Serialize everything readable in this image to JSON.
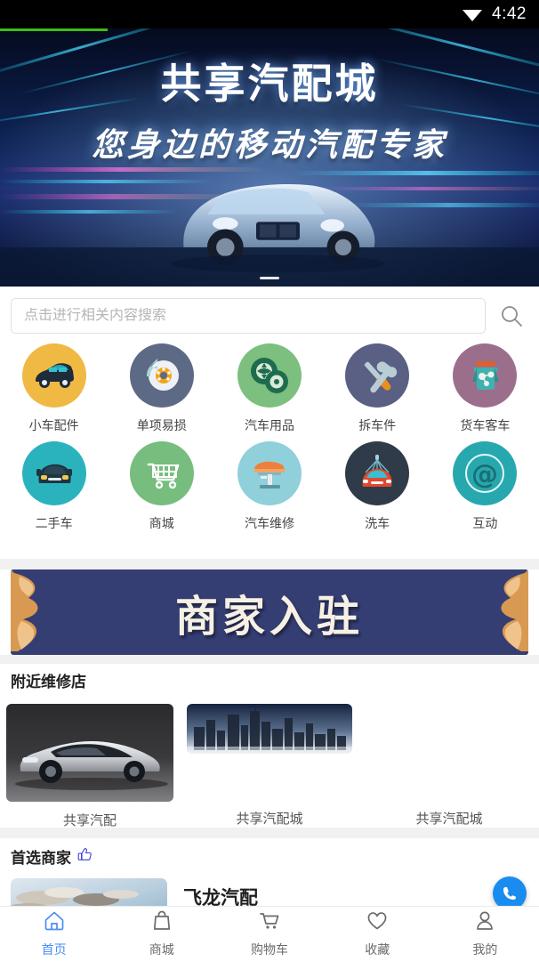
{
  "statusbar": {
    "time": "4:42",
    "wifi_icon": "wifi-icon"
  },
  "loading": {
    "progress_percent": 20
  },
  "hero": {
    "title": "共享汽配城",
    "subtitle": "您身边的移动汽配专家",
    "pager_indicator": "—"
  },
  "search": {
    "placeholder": "点击进行相关内容搜索",
    "value": "",
    "icon": "search-icon"
  },
  "categories": [
    {
      "label": "小车配件",
      "icon": "car-side-icon",
      "bg": "#f0b944"
    },
    {
      "label": "单项易损",
      "icon": "brake-disc-icon",
      "bg": "#5d6a85"
    },
    {
      "label": "汽车用品",
      "icon": "tire-icon",
      "bg": "#7cbf7e"
    },
    {
      "label": "拆车件",
      "icon": "wrench-screwdriver-icon",
      "bg": "#5a5f84"
    },
    {
      "label": "货车客车",
      "icon": "engine-icon",
      "bg": "#9b6f8c"
    },
    {
      "label": "二手车",
      "icon": "car-front-icon",
      "bg": "#2bb3bd"
    },
    {
      "label": "商城",
      "icon": "shopping-cart-icon",
      "bg": "#76bd7e"
    },
    {
      "label": "汽车维修",
      "icon": "car-lift-icon",
      "bg": "#8fd0da"
    },
    {
      "label": "洗车",
      "icon": "car-wash-icon",
      "bg": "#2f3b48"
    },
    {
      "label": "互动",
      "icon": "at-sign-icon",
      "bg": "#27a8ae"
    }
  ],
  "join_banner": {
    "text": "商家入驻",
    "bg_color": "#343e73",
    "ribbon_color": "#d39a54"
  },
  "nearby": {
    "title": "附近维修店",
    "shops": [
      {
        "name": "共享汽配",
        "image": "sports-car-photo"
      },
      {
        "name": "共享汽配城",
        "image": "city-skyline-photo"
      },
      {
        "name": "共享汽配城",
        "image": ""
      }
    ]
  },
  "preferred": {
    "title": "首选商家",
    "title_icon": "thumbs-up-icon",
    "merchant": {
      "name": "飞龙汽配",
      "image": "sky-clouds-photo"
    }
  },
  "call_button": {
    "icon": "phone-icon",
    "color": "#1a8cf0"
  },
  "tabbar": {
    "items": [
      {
        "label": "首页",
        "icon": "home-icon",
        "active": true
      },
      {
        "label": "商城",
        "icon": "shopping-bag-icon",
        "active": false
      },
      {
        "label": "购物车",
        "icon": "cart-icon",
        "active": false
      },
      {
        "label": "收藏",
        "icon": "heart-icon",
        "active": false
      },
      {
        "label": "我的",
        "icon": "person-icon",
        "active": false
      }
    ],
    "active_color": "#4a8ef5",
    "inactive_color": "#6b6b6b"
  }
}
